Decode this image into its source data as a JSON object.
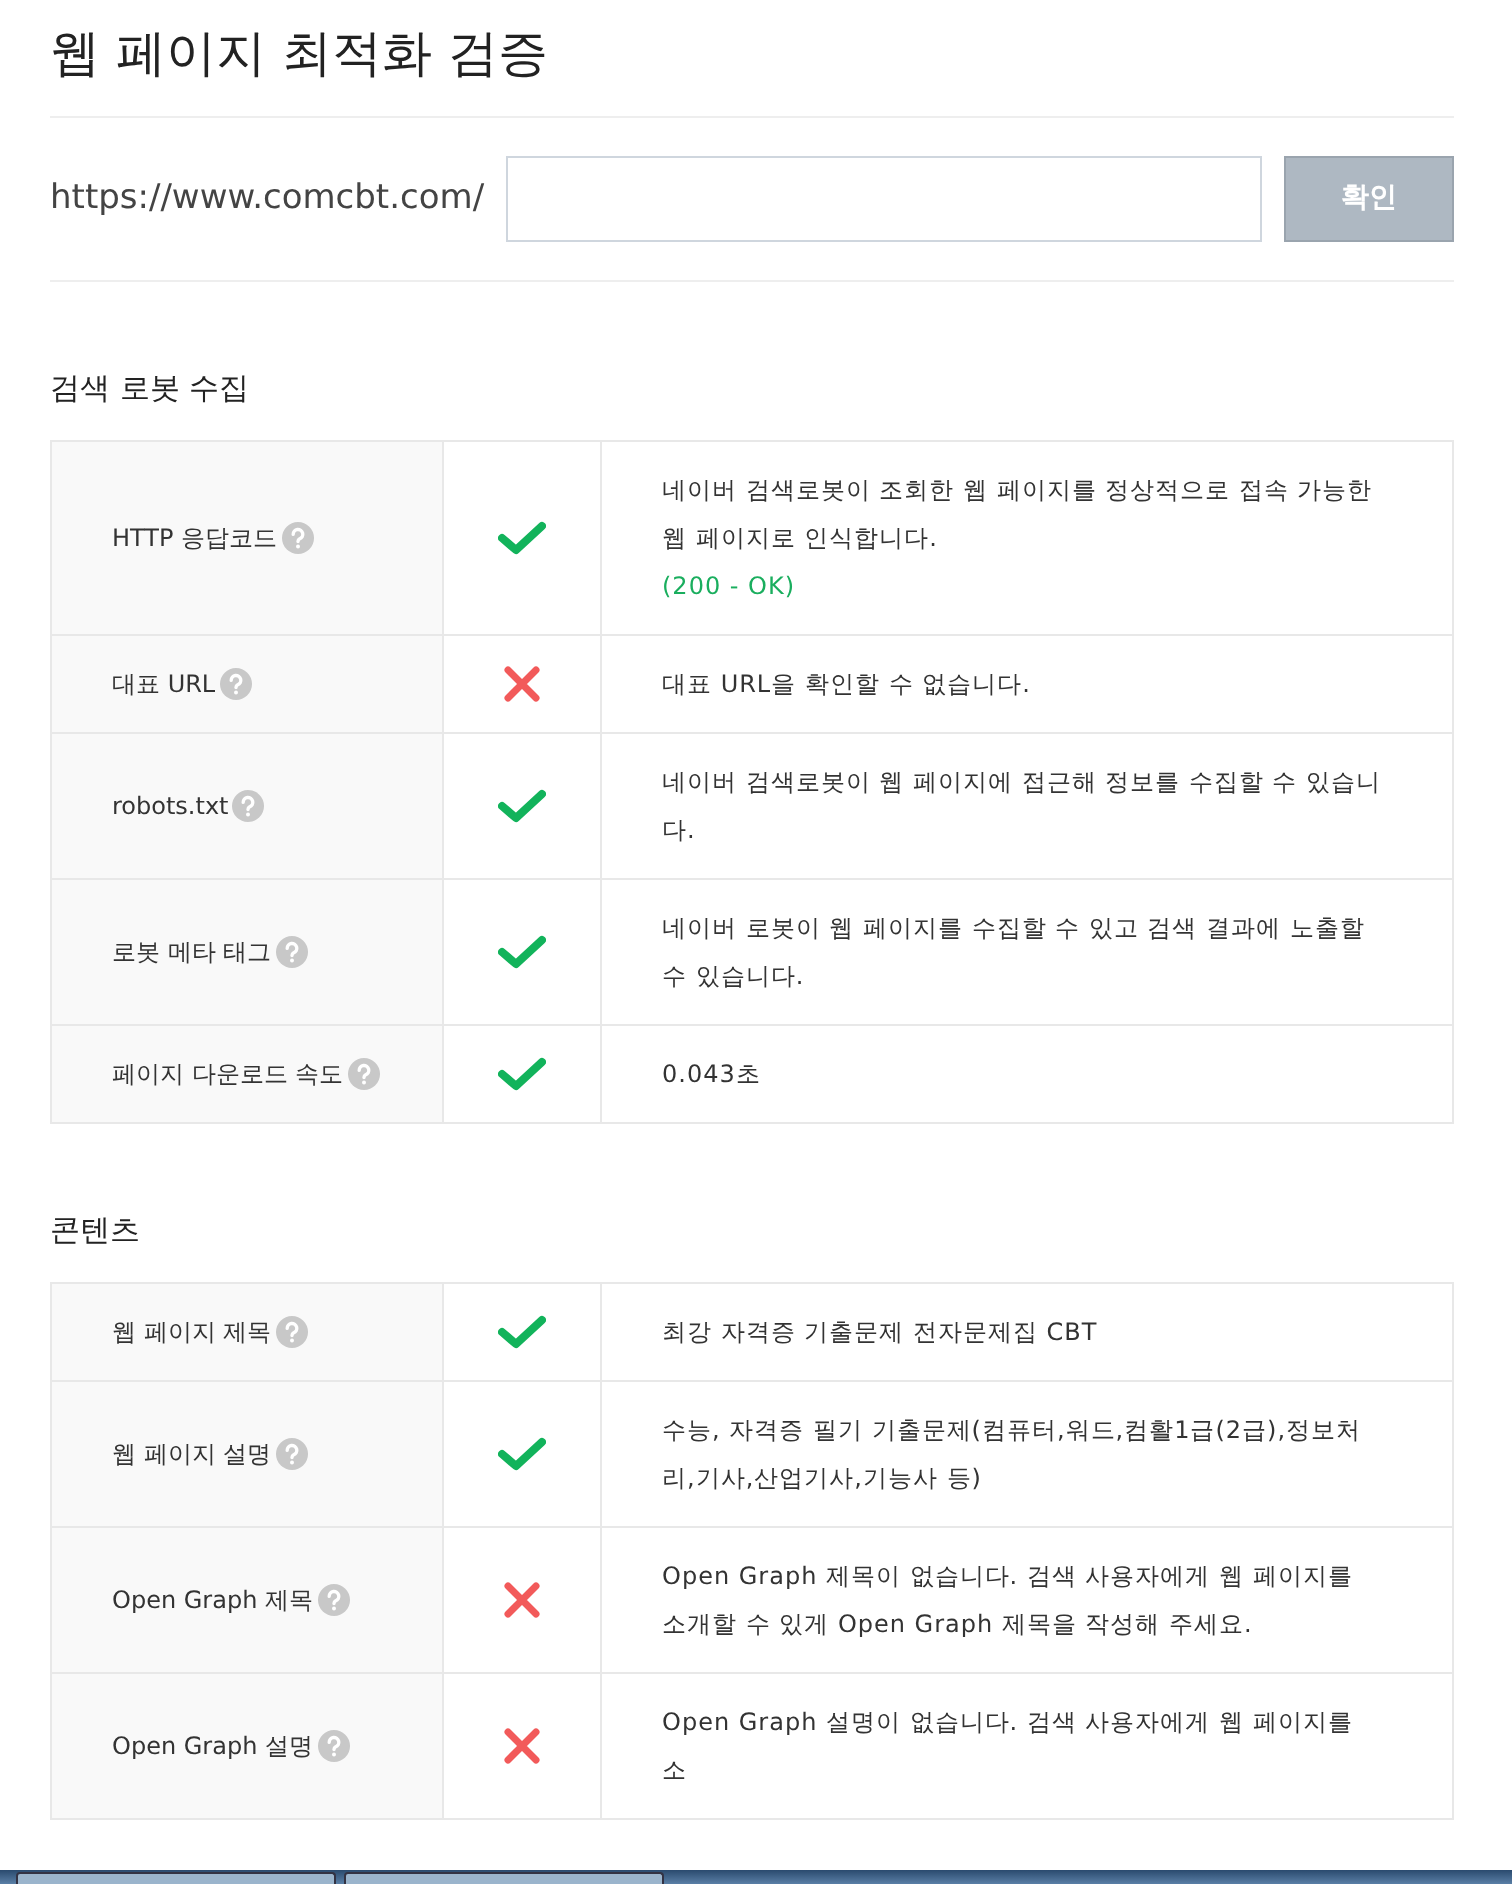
{
  "title": "웹 페이지 최적화 검증",
  "url_form": {
    "prefix": "https://www.comcbt.com/",
    "button": "확인"
  },
  "sections": [
    {
      "title": "검색 로봇 수집",
      "rows": [
        {
          "label": "HTTP 응답코드",
          "passed": true,
          "description": "네이버 검색로봇이 조회한 웹 페이지를 정상적으로 접속 가능한 웹 페이지로 인식합니다.",
          "detail": "(200 - OK)"
        },
        {
          "label": "대표 URL",
          "passed": false,
          "description": "대표 URL을 확인할 수 없습니다."
        },
        {
          "label": "robots.txt",
          "passed": true,
          "description": "네이버 검색로봇이 웹 페이지에 접근해 정보를 수집할 수 있습니다."
        },
        {
          "label": "로봇 메타 태그",
          "passed": true,
          "description": "네이버 로봇이 웹 페이지를 수집할 수 있고 검색 결과에 노출할 수 있습니다."
        },
        {
          "label": "페이지 다운로드 속도",
          "passed": true,
          "description": "0.043초"
        }
      ]
    },
    {
      "title": "콘텐츠",
      "rows": [
        {
          "label": "웹 페이지 제목",
          "passed": true,
          "description": "최강 자격증 기출문제 전자문제집 CBT"
        },
        {
          "label": "웹 페이지 설명",
          "passed": true,
          "description": "수능, 자격증 필기 기출문제(컴퓨터,워드,컴활1급(2급),정보처리,기사,산업기사,기능사 등)"
        },
        {
          "label": "Open Graph 제목",
          "passed": false,
          "description": "Open Graph 제목이 없습니다. 검색 사용자에게 웹 페이지를 소개할 수 있게 Open Graph 제목을 작성해 주세요."
        },
        {
          "label": "Open Graph 설명",
          "passed": false,
          "description": "Open Graph 설명이 없습니다. 검색 사용자에게 웹 페이지를 소"
        }
      ]
    }
  ]
}
